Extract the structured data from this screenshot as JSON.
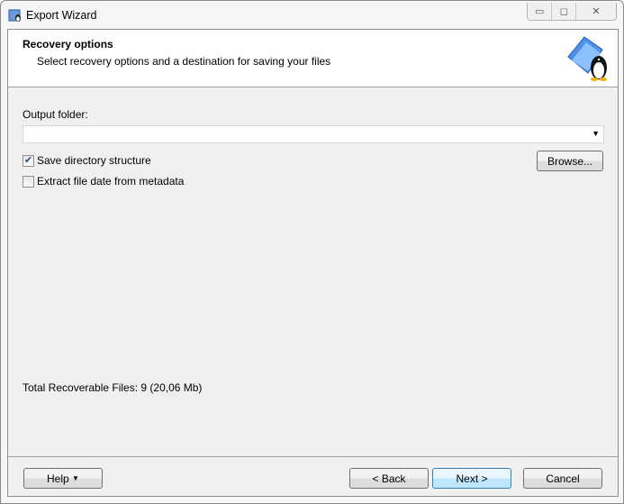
{
  "window": {
    "title": "Export Wizard",
    "controls": [
      "minimize",
      "maximize",
      "close"
    ]
  },
  "header": {
    "title": "Recovery options",
    "subtitle": "Select recovery options and a destination for saving your files",
    "logo_icon": "folder-penguin-icon"
  },
  "form": {
    "output_folder_label": "Output folder:",
    "output_folder_value": "",
    "browse_label": "Browse...",
    "save_structure": {
      "label": "Save directory structure",
      "checked": true
    },
    "extract_date": {
      "label": "Extract file date from metadata",
      "checked": false
    }
  },
  "status": {
    "total": "Total Recoverable Files: 9 (20,06 Mb)"
  },
  "footer": {
    "help": "Help",
    "back": "< Back",
    "next": "Next >",
    "cancel": "Cancel"
  }
}
